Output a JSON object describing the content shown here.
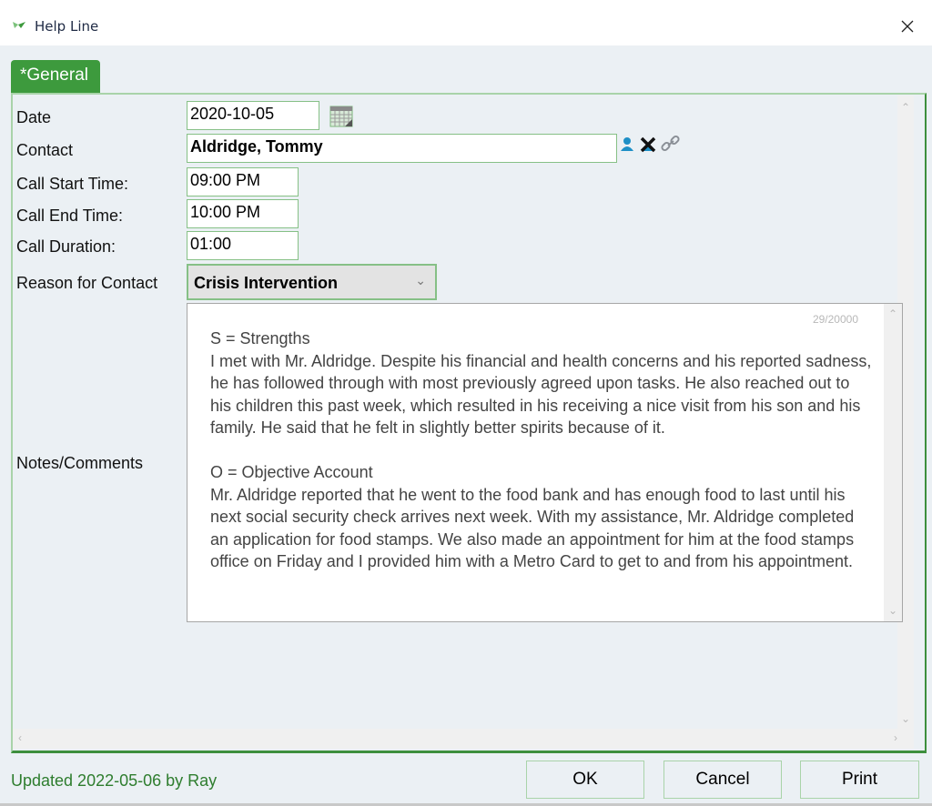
{
  "window": {
    "title": "Help Line",
    "app_icon": "leaf-icon",
    "close_icon": "close-icon"
  },
  "tabs": [
    {
      "label": "*General",
      "active": true
    }
  ],
  "form": {
    "date": {
      "label": "Date",
      "value": "2020-10-05",
      "icon": "calendar-icon"
    },
    "contact": {
      "label": "Contact",
      "value": "Aldridge, Tommy",
      "icons": [
        "person-icon",
        "clear-x-icon",
        "link-icon"
      ]
    },
    "call_start": {
      "label": "Call Start Time:",
      "value": "09:00 PM"
    },
    "call_end": {
      "label": "Call End Time:",
      "value": "10:00 PM"
    },
    "call_duration": {
      "label": "Call Duration:",
      "value": "01:00"
    },
    "reason": {
      "label": "Reason for Contact",
      "value": "Crisis Intervention"
    },
    "notes": {
      "label": "Notes/Comments",
      "counter": "29/20000",
      "value": "S = Strengths\nI met with Mr. Aldridge. Despite his financial and health concerns and his reported sadness, he has followed through with most previously agreed upon tasks. He also reached out to his children this past week, which resulted in his receiving a nice visit from his son and his family. He said that he felt in slightly better spirits because of it.\n\nO = Objective Account\nMr. Aldridge reported that he went to the food bank and has enough food to last until his next social security check arrives next week. With my assistance, Mr. Aldridge completed an application for food stamps. We also made an appointment for him at the food stamps office on Friday and I provided him with a Metro Card to get to and from his appointment."
    }
  },
  "footer": {
    "updated": "Updated 2022-05-06 by Ray",
    "ok_label": "OK",
    "cancel_label": "Cancel",
    "print_label": "Print"
  },
  "colors": {
    "accent_green": "#3d9a3d",
    "updated_text": "#2e7d2e",
    "background": "#ebf0f4"
  }
}
